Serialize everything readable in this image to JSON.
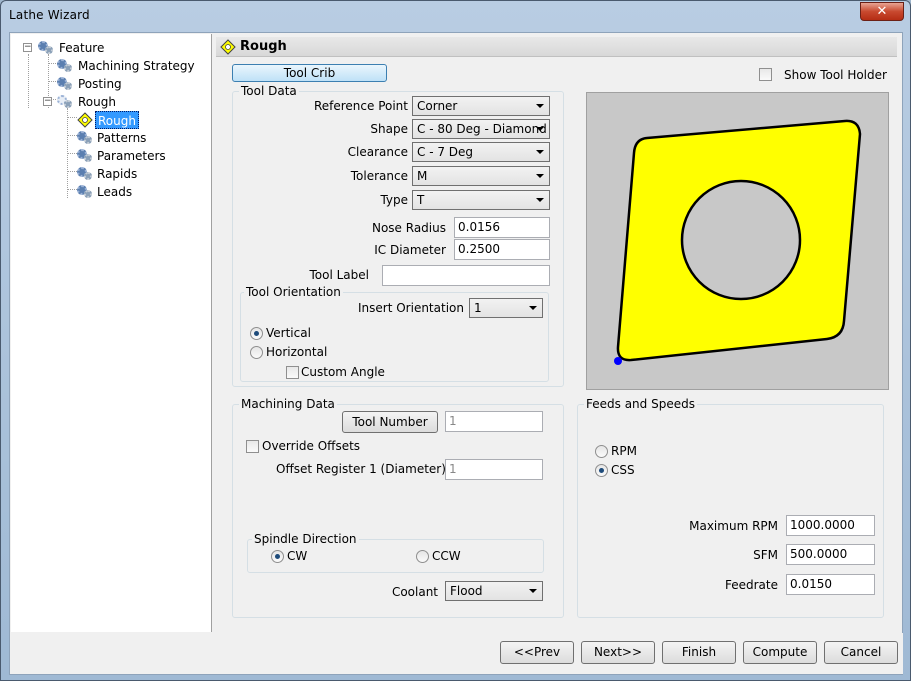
{
  "window": {
    "title": "Lathe Wizard",
    "close": "✕"
  },
  "tree": {
    "items": [
      {
        "label": "Feature"
      },
      {
        "label": "Machining Strategy"
      },
      {
        "label": "Posting"
      },
      {
        "label": "Rough"
      },
      {
        "label": "Rough"
      },
      {
        "label": "Patterns"
      },
      {
        "label": "Parameters"
      },
      {
        "label": "Rapids"
      },
      {
        "label": "Leads"
      }
    ]
  },
  "header": {
    "title": "Rough"
  },
  "tool_crib": "Tool Crib",
  "show_tool_holder": {
    "label": "Show Tool Holder",
    "checked": false
  },
  "tool_data": {
    "group": "Tool Data",
    "reference_point": {
      "label": "Reference Point",
      "value": "Corner"
    },
    "shape": {
      "label": "Shape",
      "value": "C - 80 Deg - Diamond"
    },
    "clearance": {
      "label": "Clearance",
      "value": "C - 7 Deg"
    },
    "tolerance": {
      "label": "Tolerance",
      "value": "M"
    },
    "type": {
      "label": "Type",
      "value": "T"
    },
    "nose_radius": {
      "label": "Nose Radius",
      "value": "0.0156"
    },
    "ic_diameter": {
      "label": "IC Diameter",
      "value": "0.2500"
    },
    "tool_label": {
      "label": "Tool Label",
      "value": ""
    }
  },
  "tool_orientation": {
    "group": "Tool Orientation",
    "insert_orientation": {
      "label": "Insert Orientation",
      "value": "1"
    },
    "vertical": "Vertical",
    "horizontal": "Horizontal",
    "custom_angle": "Custom Angle"
  },
  "machining_data": {
    "group": "Machining Data",
    "tool_number_btn": "Tool Number",
    "tool_number": "1",
    "override_offsets": "Override Offsets",
    "offset_register": {
      "label": "Offset Register 1 (Diameter)",
      "value": "1"
    }
  },
  "spindle": {
    "group": "Spindle Direction",
    "cw": "CW",
    "ccw": "CCW"
  },
  "coolant": {
    "label": "Coolant",
    "value": "Flood"
  },
  "feeds": {
    "group": "Feeds and Speeds",
    "rpm": "RPM",
    "css": "CSS",
    "max_rpm": {
      "label": "Maximum RPM",
      "value": "1000.0000"
    },
    "sfm": {
      "label": "SFM",
      "value": "500.0000"
    },
    "feedrate": {
      "label": "Feedrate",
      "value": "0.0150"
    }
  },
  "buttons": {
    "prev": "<<Prev",
    "next": "Next>>",
    "finish": "Finish",
    "compute": "Compute",
    "cancel": "Cancel"
  },
  "colors": {
    "insert": "#ffff00",
    "preview_bg": "#c8c8c8",
    "corner_dot": "#0000ff"
  }
}
